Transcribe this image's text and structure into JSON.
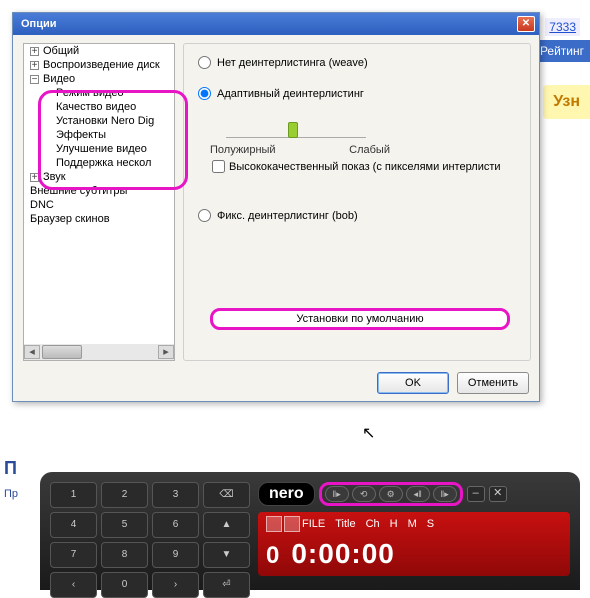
{
  "bg": {
    "link": "7333",
    "rating": "Рейтинг",
    "ad": "Узн",
    "p": "П",
    "pro": "Пр"
  },
  "dialog": {
    "title": "Опции",
    "tree": [
      {
        "label": "Общий",
        "level": "level1",
        "box": "+"
      },
      {
        "label": "Воспроизведение диск",
        "level": "level1",
        "box": "+"
      },
      {
        "label": "Видео",
        "level": "level1",
        "box": "−"
      },
      {
        "label": "Режим видео",
        "level": "level2",
        "box": ""
      },
      {
        "label": "Качество видео",
        "level": "level2",
        "box": ""
      },
      {
        "label": "Установки Nero Dig",
        "level": "level2",
        "box": ""
      },
      {
        "label": "Эффекты",
        "level": "level2",
        "box": ""
      },
      {
        "label": "Улучшение видео",
        "level": "level2",
        "box": ""
      },
      {
        "label": "Поддержка нескол",
        "level": "level2",
        "box": ""
      },
      {
        "label": "Звук",
        "level": "level1",
        "box": "+"
      },
      {
        "label": "Внешние субтитры",
        "level": "level1",
        "box": ""
      },
      {
        "label": "DNC",
        "level": "level1",
        "box": ""
      },
      {
        "label": "Браузер скинов",
        "level": "level1",
        "box": ""
      }
    ],
    "radio_none": "Нет деинтерлистинга (weave)",
    "radio_adaptive": "Адаптивный деинтерлистинг",
    "slider_left": "Полужирный",
    "slider_right": "Слабый",
    "chk_hq": "Высококачественный показ (с пикселями интерлисти",
    "radio_fixed": "Фикс. деинтерлистинг (bob)",
    "defaults": "Установки по умолчанию",
    "ok": "OK",
    "cancel": "Отменить"
  },
  "player": {
    "logo": "nero",
    "keys": [
      "1",
      "2",
      "3",
      "⌫",
      "4",
      "5",
      "6",
      "▲",
      "7",
      "8",
      "9",
      "▼",
      "‹",
      "0",
      "›",
      "⏎"
    ],
    "pills": [
      "‖▸",
      "⟲",
      "⚙",
      "◂‖",
      "‖▸"
    ],
    "disp": {
      "file": "FILE",
      "cols": [
        "Title",
        "Ch",
        "H",
        "M",
        "S"
      ],
      "track": "0",
      "time": "0:00:00"
    }
  }
}
